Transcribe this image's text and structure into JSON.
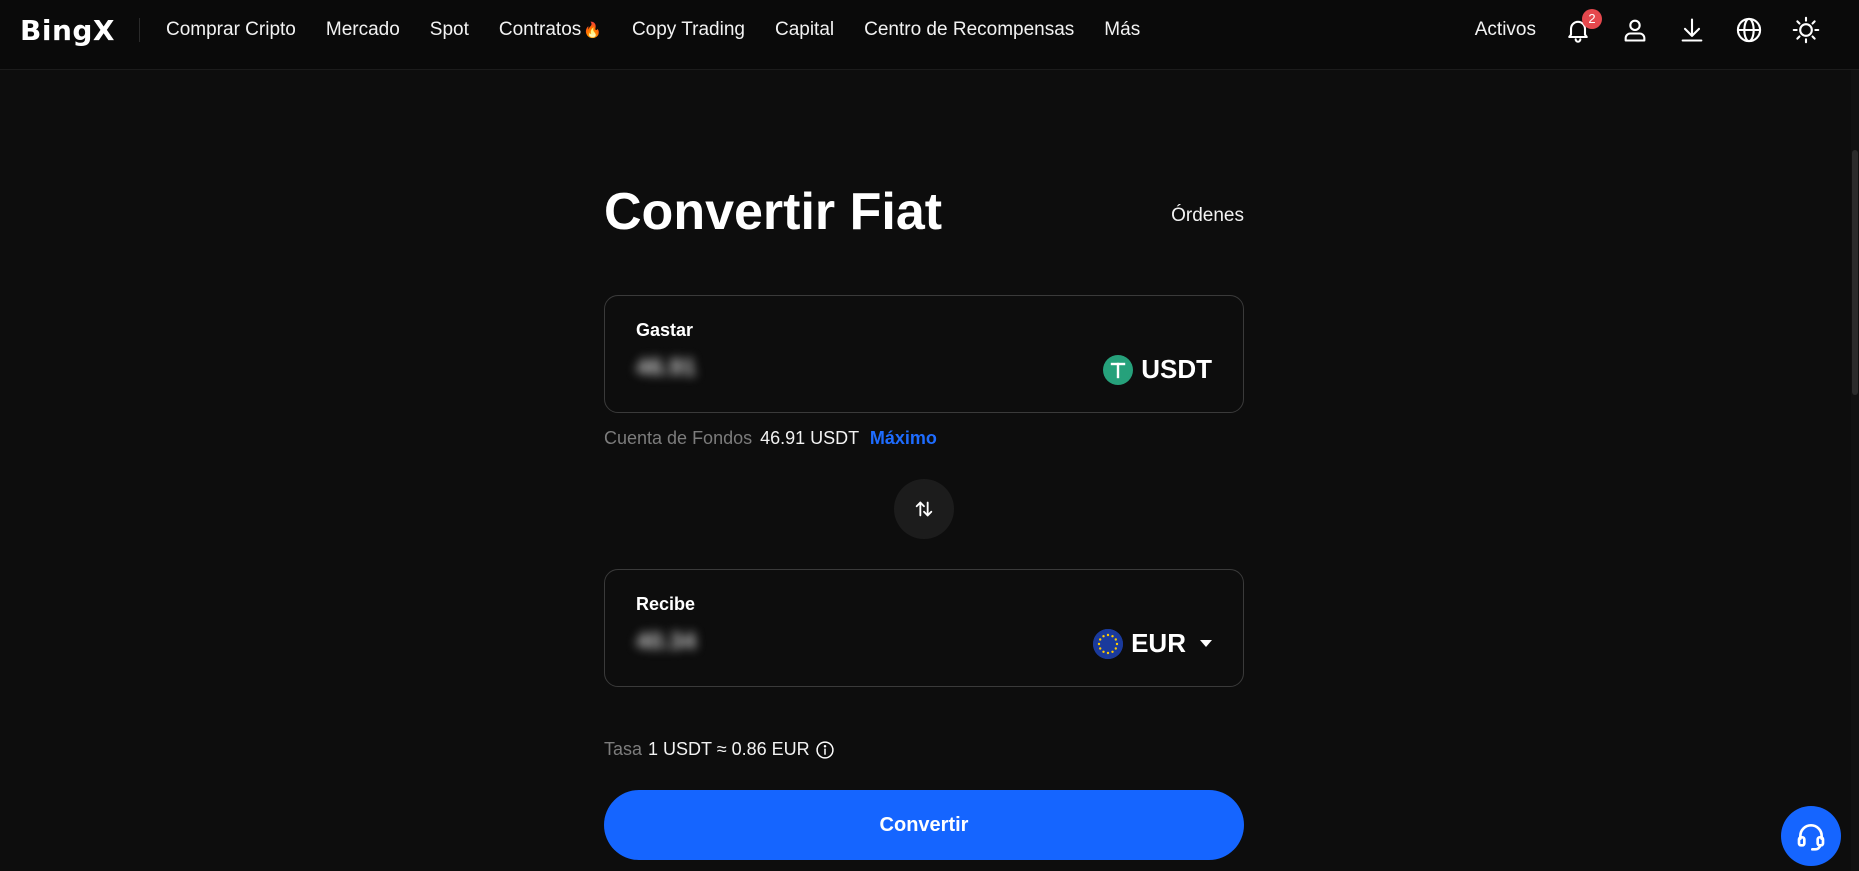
{
  "brand": {
    "logo_text": "BingX"
  },
  "nav": {
    "items": [
      {
        "label": "Comprar Cripto"
      },
      {
        "label": "Mercado"
      },
      {
        "label": "Spot"
      },
      {
        "label": "Contratos",
        "icon": "fire-icon",
        "icon_glyph": "🔥"
      },
      {
        "label": "Copy Trading"
      },
      {
        "label": "Capital"
      },
      {
        "label": "Centro de Recompensas"
      },
      {
        "label": "Más"
      }
    ],
    "activos_label": "Activos",
    "notification_count": "2",
    "icons": [
      "bell-icon",
      "user-icon",
      "download-icon",
      "globe-icon",
      "sun-icon"
    ]
  },
  "page": {
    "title": "Convertir Fiat",
    "orders_label": "Órdenes"
  },
  "spend": {
    "label": "Gastar",
    "amount": "46.91",
    "currency": "USDT",
    "currency_icon": "usdt-coin-icon"
  },
  "funds": {
    "label": "Cuenta de Fondos",
    "value": "46.91 USDT",
    "max_label": "Máximo"
  },
  "receive": {
    "label": "Recibe",
    "amount": "40.34",
    "currency": "EUR",
    "currency_icon": "eur-flag-icon"
  },
  "rate": {
    "label": "Tasa",
    "value": "1 USDT ≈ 0.86 EUR"
  },
  "convert_button": "Convertir",
  "colors": {
    "background": "#0d0d0d",
    "accent": "#1565ff",
    "badge": "#e5484d",
    "usdt": "#26a17b"
  }
}
